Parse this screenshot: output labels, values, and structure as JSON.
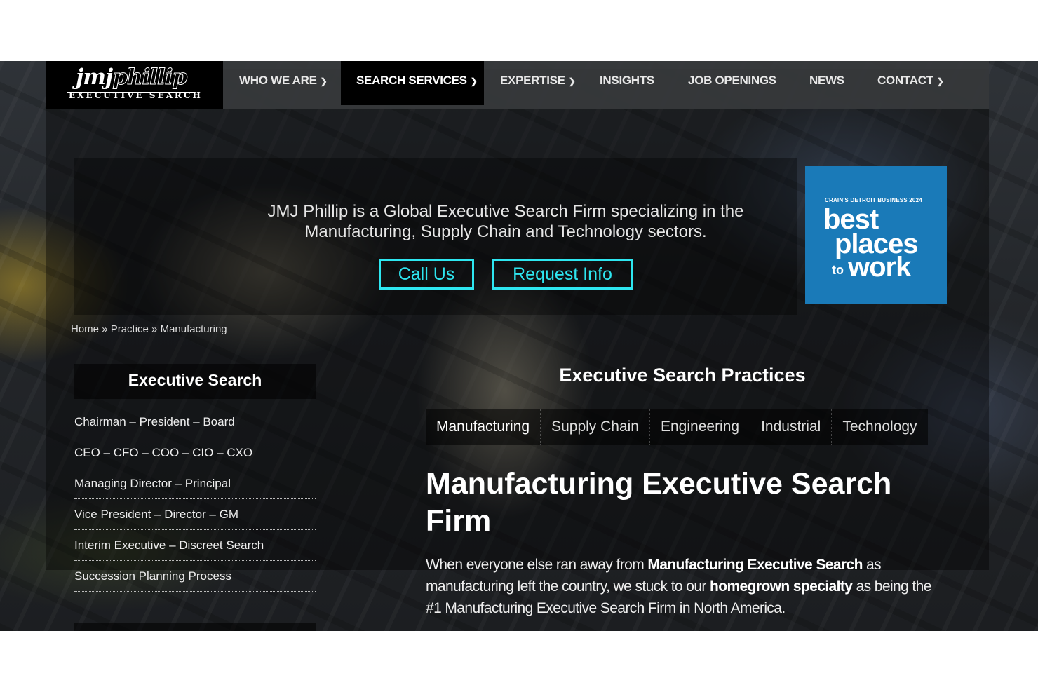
{
  "logo": {
    "brand_main": "jmj",
    "brand_phillip": "phillip",
    "tagline": "EXECUTIVE SEARCH"
  },
  "nav": {
    "items": [
      {
        "label": "WHO WE ARE",
        "dropdown": true
      },
      {
        "label": "SEARCH SERVICES",
        "dropdown": true,
        "active": true
      },
      {
        "label": "EXPERTISE",
        "dropdown": true
      },
      {
        "label": "INSIGHTS",
        "dropdown": false
      },
      {
        "label": "JOB OPENINGS",
        "dropdown": false
      },
      {
        "label": "NEWS",
        "dropdown": false
      },
      {
        "label": "CONTACT",
        "dropdown": true
      }
    ]
  },
  "intro": {
    "text": "JMJ Phillip is a Global Executive Search Firm specializing in the Manufacturing, Supply Chain and Technology sectors.",
    "call_us": "Call Us",
    "request_info": "Request Info"
  },
  "award": {
    "small": "CRAIN'S DETROIT BUSINESS 2024",
    "line1": "best",
    "line2": "places",
    "to": "to",
    "line3": "work"
  },
  "breadcrumb": {
    "home": "Home",
    "sep": "»",
    "practice": "Practice",
    "current": "Manufacturing"
  },
  "sidebar": {
    "title": "Executive Search",
    "items": [
      "Chairman – President – Board",
      "CEO – CFO – COO – CIO – CXO",
      "Managing Director – Principal",
      "Vice President – Director – GM",
      "Interim Executive – Discreet Search",
      "Succession Planning Process"
    ]
  },
  "main": {
    "heading": "Executive Search Practices",
    "tabs": [
      "Manufacturing",
      "Supply Chain",
      "Engineering",
      "Industrial",
      "Technology"
    ],
    "title": "Manufacturing Executive Search Firm",
    "body_1": "When everyone else ran away from ",
    "body_bold_1": "Manufacturing Executive Search",
    "body_2": " as manufacturing left the country, we stuck to our ",
    "body_bold_2": "homegrown specialty",
    "body_3": " as being the #1 Manufacturing Executive Search Firm in North America."
  },
  "colors": {
    "accent": "#2ee6f0",
    "award_bg": "#1a7ab8",
    "nav_bg": "#37393c",
    "active_nav": "#000000"
  }
}
